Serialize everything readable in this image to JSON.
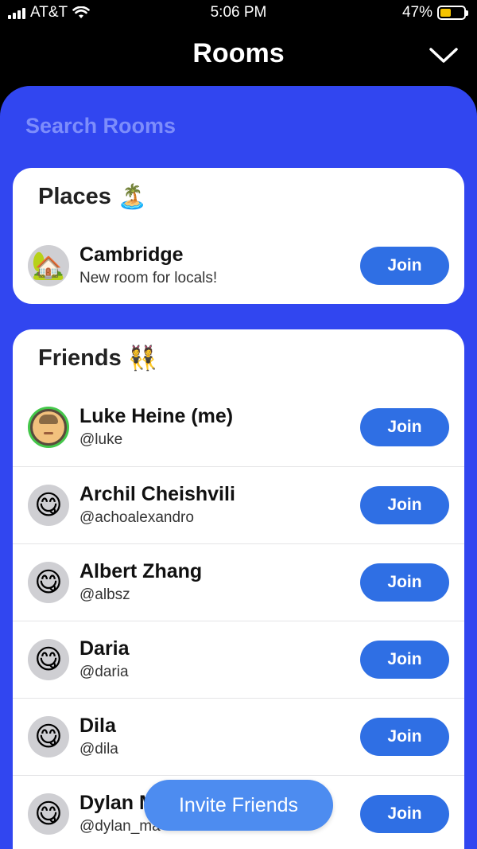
{
  "status_bar": {
    "carrier": "AT&T",
    "time": "5:06 PM",
    "battery": "47%",
    "battery_level": 0.47,
    "battery_color": "#f5c400"
  },
  "header": {
    "title": "Rooms",
    "collapse_icon": "chevron-down-icon"
  },
  "search": {
    "placeholder": "Search Rooms"
  },
  "places": {
    "title": "Places",
    "title_emoji": "🏝️",
    "rooms": [
      {
        "name": "Cambridge",
        "subtitle": "New room for locals!",
        "avatar_emoji": "🏡",
        "join_label": "Join"
      }
    ]
  },
  "friends": {
    "title": "Friends",
    "title_emoji": "👯",
    "items": [
      {
        "name": "Luke Heine (me)",
        "handle": "@luke",
        "avatar": "profile-photo",
        "join_label": "Join"
      },
      {
        "name": "Archil Cheishvili",
        "handle": "@achoalexandro",
        "avatar_emoji": "😋",
        "join_label": "Join"
      },
      {
        "name": "Albert Zhang",
        "handle": "@albsz",
        "avatar_emoji": "😋",
        "join_label": "Join"
      },
      {
        "name": "Daria",
        "handle": "@daria",
        "avatar_emoji": "😋",
        "join_label": "Join"
      },
      {
        "name": "Dila",
        "handle": "@dila",
        "avatar_emoji": "😋",
        "join_label": "Join"
      },
      {
        "name": "Dylan M",
        "handle": "@dylan_ma",
        "avatar_emoji": "😋",
        "join_label": "Join"
      }
    ]
  },
  "invite": {
    "label": "Invite Friends"
  },
  "colors": {
    "panel": "#3146f0",
    "button": "#2f6fe4",
    "invite": "#4d8cf0",
    "search_text": "#7d8dfb",
    "me_ring": "#44c74a"
  }
}
